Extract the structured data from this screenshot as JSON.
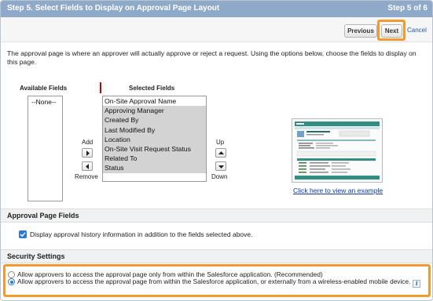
{
  "header": {
    "title": "Step 5. Select Fields to Display on Approval Page Layout",
    "step": "Step 5 of 6"
  },
  "toolbar": {
    "previous_label": "Previous",
    "next_label": "Next",
    "cancel_label": "Cancel"
  },
  "intro": "The approval page is where an approver will actually approve or reject a request. Using the options below, choose the fields to display on this page.",
  "available": {
    "label": "Available Fields",
    "options": [
      "--None--"
    ]
  },
  "selected": {
    "label": "Selected Fields",
    "options": [
      "On-Site Approval Name",
      "Approving Manager",
      "Created By",
      "Last Modified By",
      "Location",
      "On-Site Visit Request Status",
      "Related To",
      "Status"
    ]
  },
  "controls": {
    "add_label": "Add",
    "remove_label": "Remove",
    "up_label": "Up",
    "down_label": "Down"
  },
  "example": {
    "link_label": "Click here to view an example"
  },
  "approval_page_fields": {
    "title": "Approval Page Fields",
    "history_checkbox_label": "Display approval history information in addition to the fields selected above.",
    "history_checked": true
  },
  "security": {
    "title": "Security Settings",
    "option1": "Allow approvers to access the approval page only from within the Salesforce application. (Recommended)",
    "option2": "Allow approvers to access the approval page from within the Salesforce application, or externally from a wireless-enabled mobile device.",
    "selected_option": 2
  },
  "colors": {
    "header_bg": "#8fa9c9",
    "highlight": "#f29a2e",
    "link": "#1a5aa8",
    "accent": "#2a78d6"
  }
}
